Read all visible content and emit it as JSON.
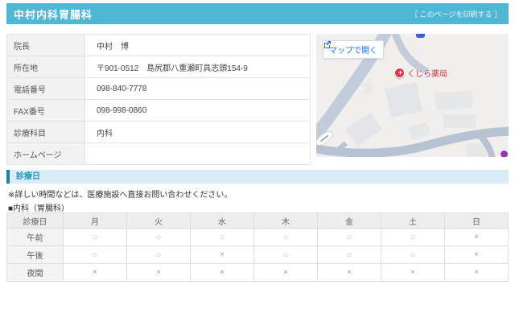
{
  "header": {
    "title": "中村内科胃腸科",
    "print_link": "［ このページを印刷する ］"
  },
  "info_table": {
    "rows": [
      {
        "label": "院長",
        "value": "中村　博"
      },
      {
        "label": "所在地",
        "value": "〒901-0512　島尻郡八重瀬町具志頭154-9"
      },
      {
        "label": "電話番号",
        "value": "098-840-7778"
      },
      {
        "label": "FAX番号",
        "value": "098-998-0860"
      },
      {
        "label": "診療科目",
        "value": "内科"
      },
      {
        "label": "ホームページ",
        "value": ""
      }
    ]
  },
  "map": {
    "open_button_label": "マップで開く",
    "poi_label": "くじら薬局",
    "marker_color": "#dd3b4d",
    "road_color": "#c2ccda",
    "building_color": "#e6e7e9"
  },
  "schedule": {
    "section_title": "診療日",
    "note": "※詳しい時間などは、医療施設へ直接お問い合わせください。",
    "department": "■内科（胃腸科）",
    "columns": [
      "診療日",
      "月",
      "火",
      "水",
      "木",
      "金",
      "土",
      "日"
    ],
    "rows": [
      {
        "label": "午前",
        "marks": [
          "○",
          "○",
          "○",
          "○",
          "○",
          "○",
          "×"
        ]
      },
      {
        "label": "午後",
        "marks": [
          "○",
          "○",
          "×",
          "○",
          "○",
          "○",
          "×"
        ]
      },
      {
        "label": "夜間",
        "marks": [
          "×",
          "×",
          "×",
          "×",
          "×",
          "×",
          "×"
        ]
      }
    ]
  }
}
